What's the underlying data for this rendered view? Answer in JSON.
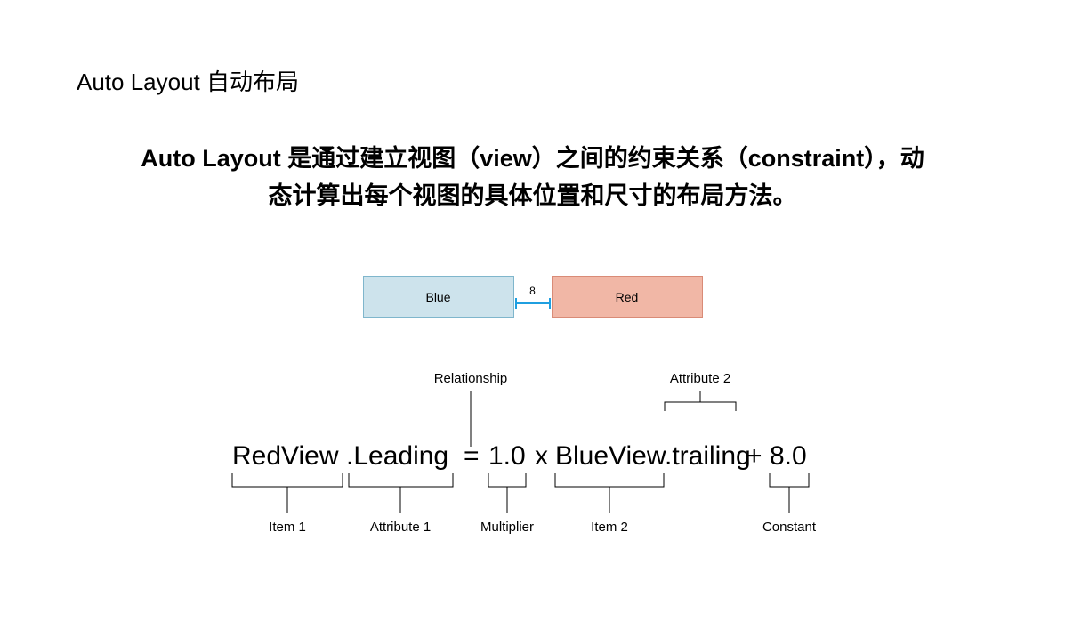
{
  "title": "Auto Layout 自动布局",
  "description_line1": "Auto Layout 是通过建立视图（view）之间的约束关系（constraint），动",
  "description_line2": "态计算出每个视图的具体位置和尺寸的布局方法。",
  "boxes": {
    "blue_label": "Blue",
    "red_label": "Red",
    "gap_value": "8"
  },
  "equation": {
    "item1": "RedView",
    "attr1": ".Leading",
    "rel": "=",
    "mult": "1.0",
    "times": "x",
    "item2": "BlueView",
    "attr2": ".trailing",
    "plus": "+",
    "const": "8.0"
  },
  "labels": {
    "relationship": "Relationship",
    "attribute2": "Attribute 2",
    "item1": "Item 1",
    "attribute1": "Attribute 1",
    "multiplier": "Multiplier",
    "item2": "Item 2",
    "constant": "Constant"
  }
}
